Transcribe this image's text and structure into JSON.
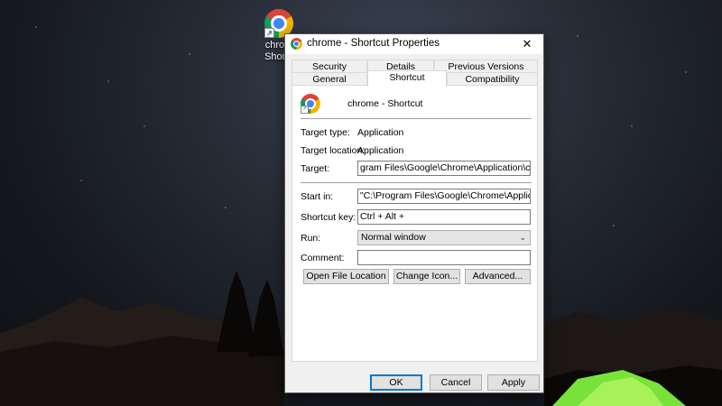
{
  "desktop": {
    "icon_label_line1": "chrom",
    "icon_label_line2": "Shortc"
  },
  "dialog": {
    "title": "chrome - Shortcut Properties",
    "close_glyph": "✕",
    "tabs_row1": [
      "Security",
      "Details",
      "Previous Versions"
    ],
    "tabs_row2": [
      "General",
      "Shortcut",
      "Compatibility"
    ],
    "active_tab": "Shortcut",
    "shortcut": {
      "name": "chrome - Shortcut",
      "target_type_label": "Target type:",
      "target_type_value": "Application",
      "target_location_label": "Target location:",
      "target_location_value": "Application",
      "target_label": "Target:",
      "target_value": "gram Files\\Google\\Chrome\\Application\\chrome.exe\"",
      "start_in_label": "Start in:",
      "start_in_value": "\"C:\\Program Files\\Google\\Chrome\\Application\"",
      "shortcut_key_label": "Shortcut key:",
      "shortcut_key_value": "Ctrl + Alt +",
      "run_label": "Run:",
      "run_value": "Normal window",
      "comment_label": "Comment:",
      "comment_value": "",
      "open_file_location": "Open File Location",
      "change_icon": "Change Icon...",
      "advanced": "Advanced..."
    },
    "buttons": {
      "ok": "OK",
      "cancel": "Cancel",
      "apply": "Apply"
    }
  },
  "icons": [
    "chrome-icon",
    "shortcut-arrow-icon",
    "close-icon",
    "chevron-down-icon"
  ]
}
